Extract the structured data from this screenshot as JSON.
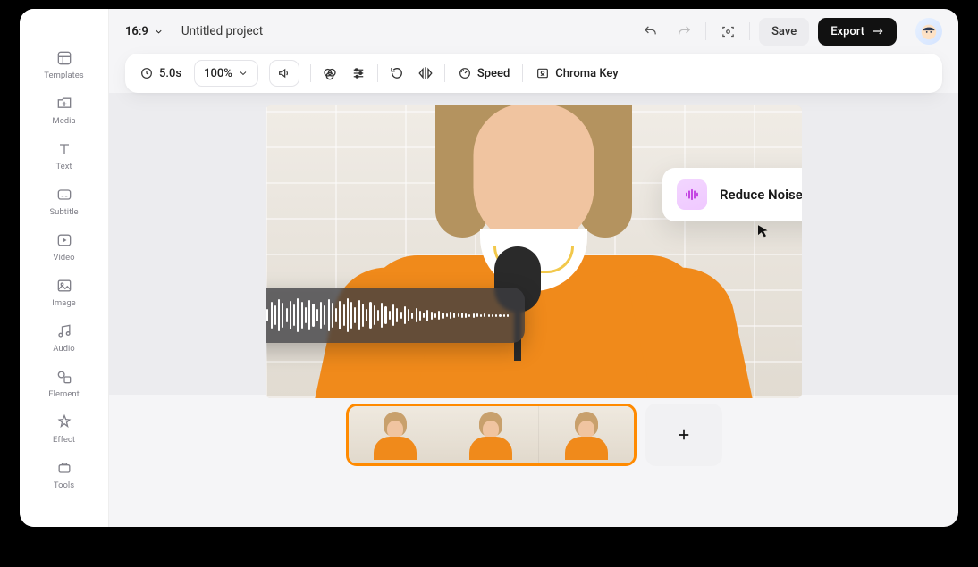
{
  "sidebar": {
    "items": [
      {
        "label": "Templates"
      },
      {
        "label": "Media"
      },
      {
        "label": "Text"
      },
      {
        "label": "Subtitle"
      },
      {
        "label": "Video"
      },
      {
        "label": "Image"
      },
      {
        "label": "Audio"
      },
      {
        "label": "Element"
      },
      {
        "label": "Effect"
      },
      {
        "label": "Tools"
      }
    ]
  },
  "header": {
    "ratio": "16:9",
    "project_name": "Untitled project",
    "save": "Save",
    "export": "Export"
  },
  "toolbar": {
    "duration": "5.0s",
    "zoom": "100%",
    "speed": "Speed",
    "chroma": "Chroma Key"
  },
  "overlay": {
    "reduce_noise": "Reduce Noise"
  },
  "timeline": {
    "add": "+"
  }
}
